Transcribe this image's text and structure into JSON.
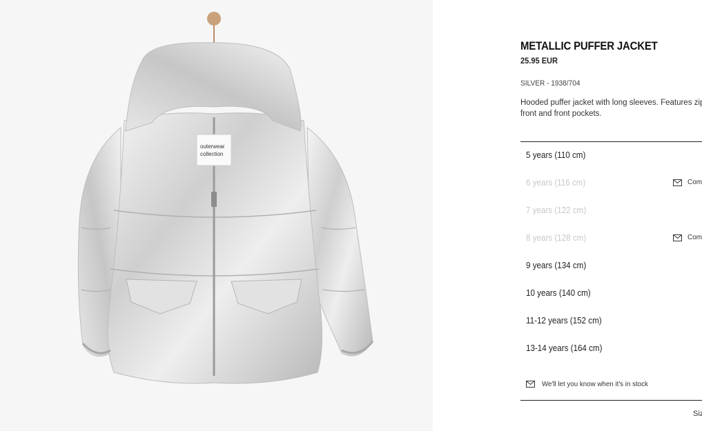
{
  "product": {
    "title": "METALLIC PUFFER JACKET",
    "price": "25.95 EUR",
    "color_ref": "SILVER - 1938/704",
    "description": "Hooded puffer jacket with long sleeves. Features zip-up front and front pockets."
  },
  "sizes": [
    {
      "label": "5 years (110 cm)",
      "available": true,
      "status": ""
    },
    {
      "label": "6 years (116 cm)",
      "available": false,
      "status": "Coming soon"
    },
    {
      "label": "7 years (122 cm)",
      "available": false,
      "status": ""
    },
    {
      "label": "8 years (128 cm)",
      "available": false,
      "status": "Coming soon"
    },
    {
      "label": "9 years (134 cm)",
      "available": true,
      "status": ""
    },
    {
      "label": "10 years (140 cm)",
      "available": true,
      "status": ""
    },
    {
      "label": "11-12 years (152 cm)",
      "available": true,
      "status": ""
    },
    {
      "label": "13-14 years (164 cm)",
      "available": true,
      "status": ""
    }
  ],
  "notify_text": "We'll let you know when it's in stock",
  "size_guide_label": "Size guide",
  "image": {
    "tag_text_1": "outerwear",
    "tag_text_2": "collection",
    "colors": {
      "jacket": "#d9d9d9",
      "background": "#f6f6f6",
      "hanger_knob": "#c9a27c"
    }
  },
  "icons": {
    "mail": "envelope-icon"
  }
}
